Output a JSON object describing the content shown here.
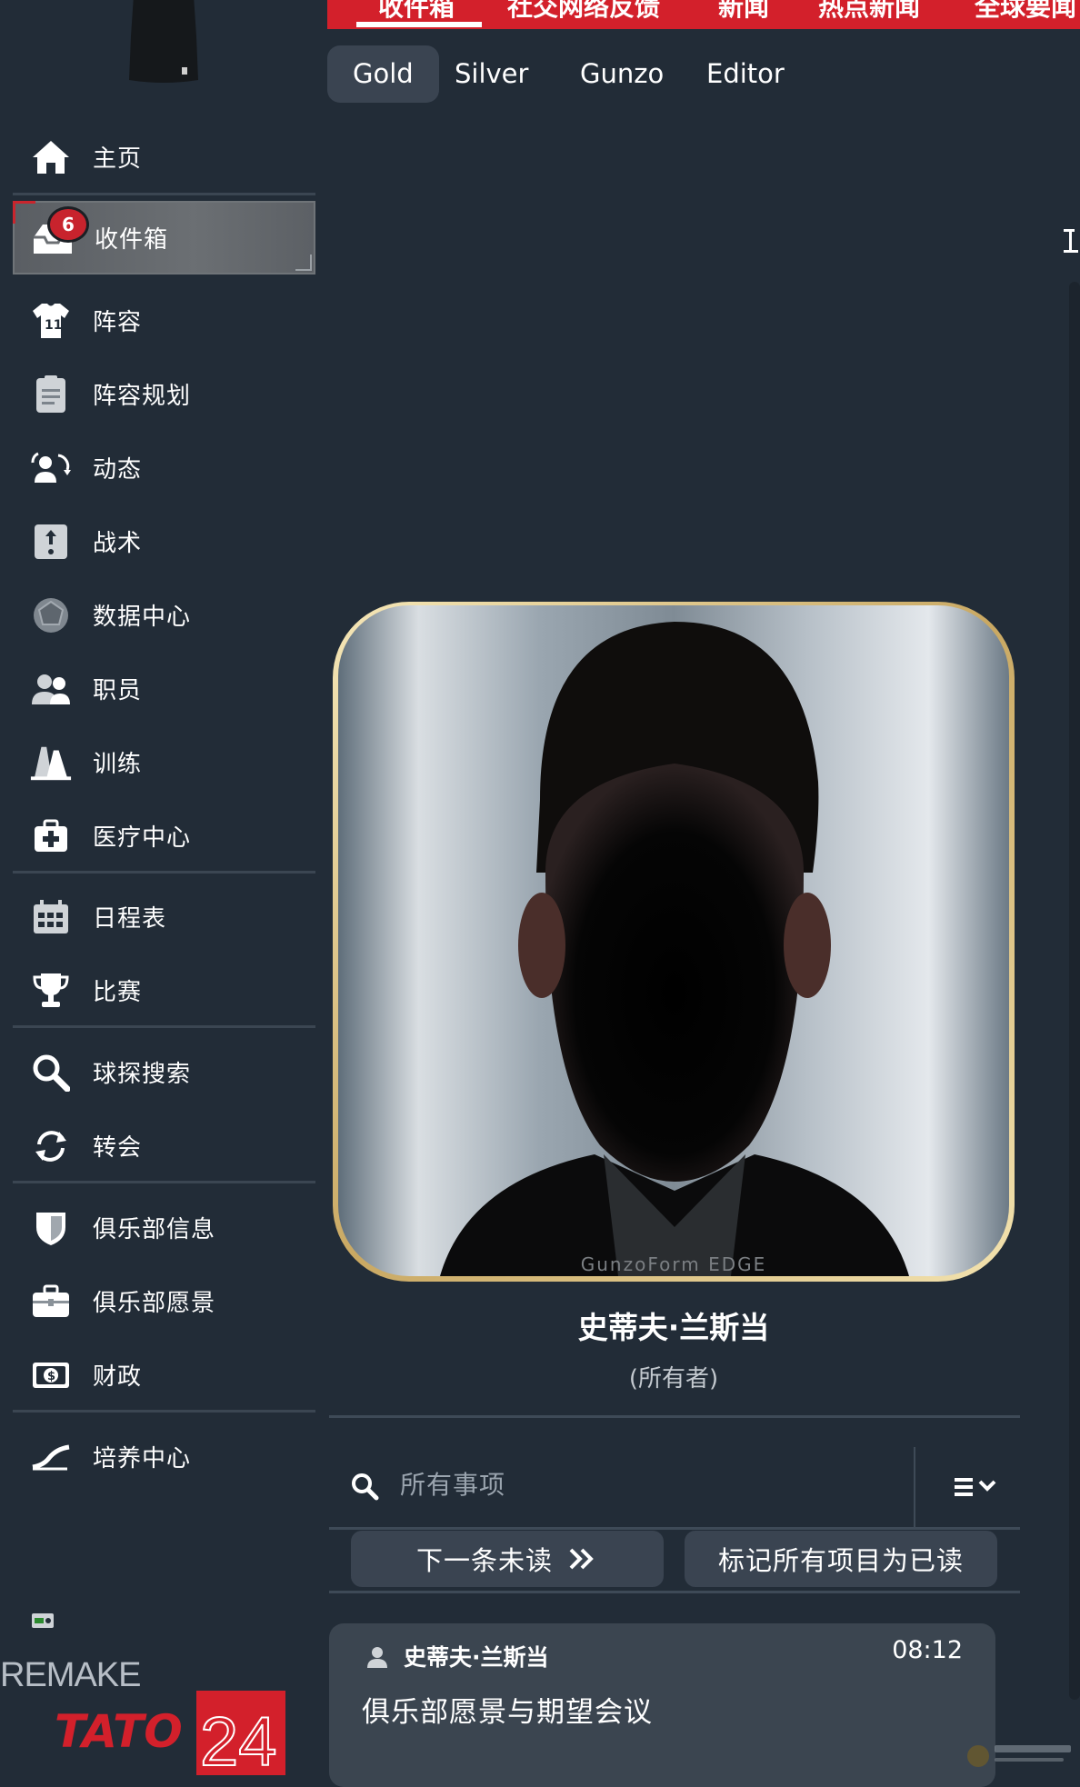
{
  "sidebar": {
    "items": [
      {
        "label": "主页",
        "icon": "home-icon"
      },
      {
        "label": "收件箱",
        "icon": "inbox-icon",
        "badge": "6",
        "active": true
      },
      {
        "label": "阵容",
        "icon": "jersey-icon"
      },
      {
        "label": "阵容规划",
        "icon": "clipboard-icon"
      },
      {
        "label": "动态",
        "icon": "dynamics-icon"
      },
      {
        "label": "战术",
        "icon": "tactics-icon"
      },
      {
        "label": "数据中心",
        "icon": "data-hub-icon"
      },
      {
        "label": "职员",
        "icon": "staff-icon"
      },
      {
        "label": "训练",
        "icon": "training-cone-icon"
      },
      {
        "label": "医疗中心",
        "icon": "medical-kit-icon"
      },
      {
        "label": "日程表",
        "icon": "calendar-icon"
      },
      {
        "label": "比赛",
        "icon": "trophy-icon"
      },
      {
        "label": "球探搜索",
        "icon": "magnifier-icon"
      },
      {
        "label": "转会",
        "icon": "transfer-icon"
      },
      {
        "label": "俱乐部信息",
        "icon": "shield-icon"
      },
      {
        "label": "俱乐部愿景",
        "icon": "briefcase-icon"
      },
      {
        "label": "财政",
        "icon": "money-icon"
      },
      {
        "label": "培养中心",
        "icon": "development-icon"
      }
    ],
    "branding": {
      "remake": "REMAKE",
      "logo_text": "TATO",
      "logo_number": "24"
    }
  },
  "topbar": {
    "tabs": [
      "收件箱",
      "社交网络反馈",
      "新闻",
      "热点新闻",
      "全球要闻"
    ],
    "active_index": 0
  },
  "subtabs": {
    "items": [
      "Gold",
      "Silver",
      "Gunzo",
      "Editor"
    ],
    "active_index": 0
  },
  "portrait": {
    "watermark": "GunzoForm EDGE"
  },
  "person": {
    "name": "史蒂夫·兰斯当",
    "role": "(所有者)"
  },
  "search": {
    "placeholder": "所有事项"
  },
  "actions": {
    "next_unread": "下一条未读",
    "mark_all_read": "标记所有项目为已读"
  },
  "message": {
    "sender": "史蒂夫·兰斯当",
    "time": "08:12",
    "subject": "俱乐部愿景与期望会议"
  },
  "colors": {
    "background": "#222c37",
    "accent_red": "#d3202b",
    "panel": "#3a4451",
    "badge": "#c8232d"
  }
}
